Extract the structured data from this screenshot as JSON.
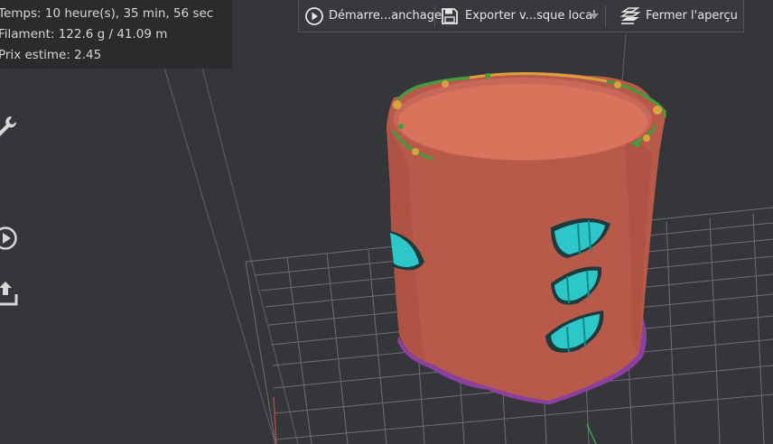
{
  "stats": {
    "time": "Temps: 10 heure(s), 35 min, 56 sec",
    "filament": "Filament: 122.6 g / 41.09 m",
    "price": "Prix estime: 2.45"
  },
  "toolbar": {
    "start_slicing_label": "Démarre...anchage",
    "export_label": "Exporter v...sque local",
    "close_preview_label": "Fermer l'aperçu"
  },
  "sidebar": {
    "icons": [
      "wrench-icon",
      "play-icon",
      "upload-icon"
    ]
  },
  "colors": {
    "background": "#343639",
    "grid": "#5a5c5f",
    "outer_wall": "#b85a4a",
    "inner_wall": "#cf6a52",
    "support": "#2ec7c9",
    "skirt": "#8b3f9e",
    "infill_edge": "#3ca03c"
  }
}
